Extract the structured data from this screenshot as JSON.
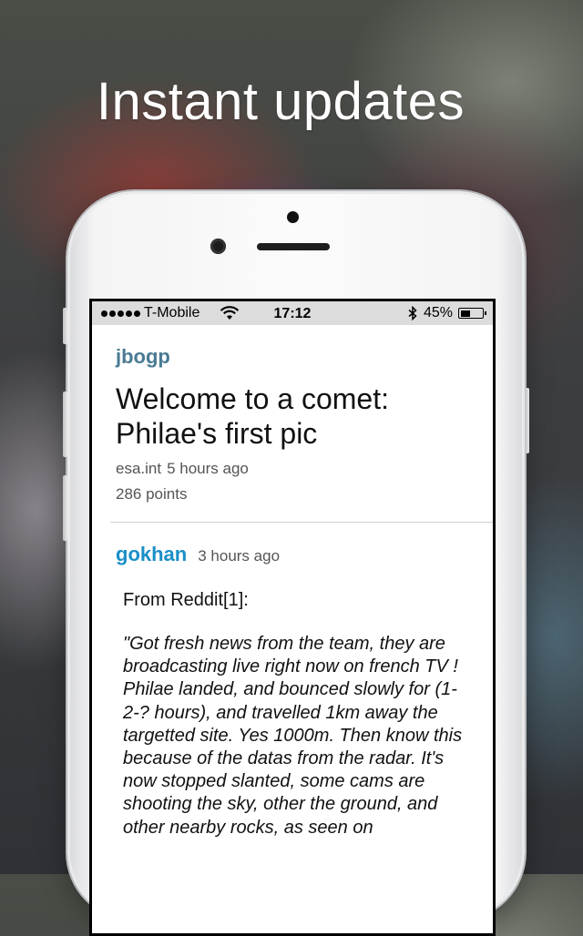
{
  "promo": {
    "headline": "Instant updates"
  },
  "status_bar": {
    "carrier": "T-Mobile",
    "time": "17:12",
    "battery_percent": "45%",
    "battery_level": 0.45
  },
  "story": {
    "author": "jbogp",
    "title": "Welcome to a comet: Philae's first pic",
    "domain": "esa.int",
    "time_ago": "5 hours ago",
    "points": "286 points"
  },
  "comment": {
    "author": "gokhan",
    "time_ago": "3 hours ago",
    "intro": "From Reddit[1]:",
    "quote": "\"Got fresh news from the team, they are broadcasting live right now on french TV ! Philae landed, and bounced slowly for (1-2-? hours), and travelled 1km away the targetted site. Yes 1000m. Then know this because of the datas from the radar. It's now stopped slanted, some cams are shooting the sky, other the ground, and other nearby rocks, as seen on"
  },
  "colors": {
    "story_author": "#4a7a94",
    "comment_author": "#1a8fc7",
    "status_bar_bg": "#dcdcdc"
  },
  "icons": [
    "signal-dots-icon",
    "wifi-icon",
    "bluetooth-icon",
    "battery-icon"
  ]
}
